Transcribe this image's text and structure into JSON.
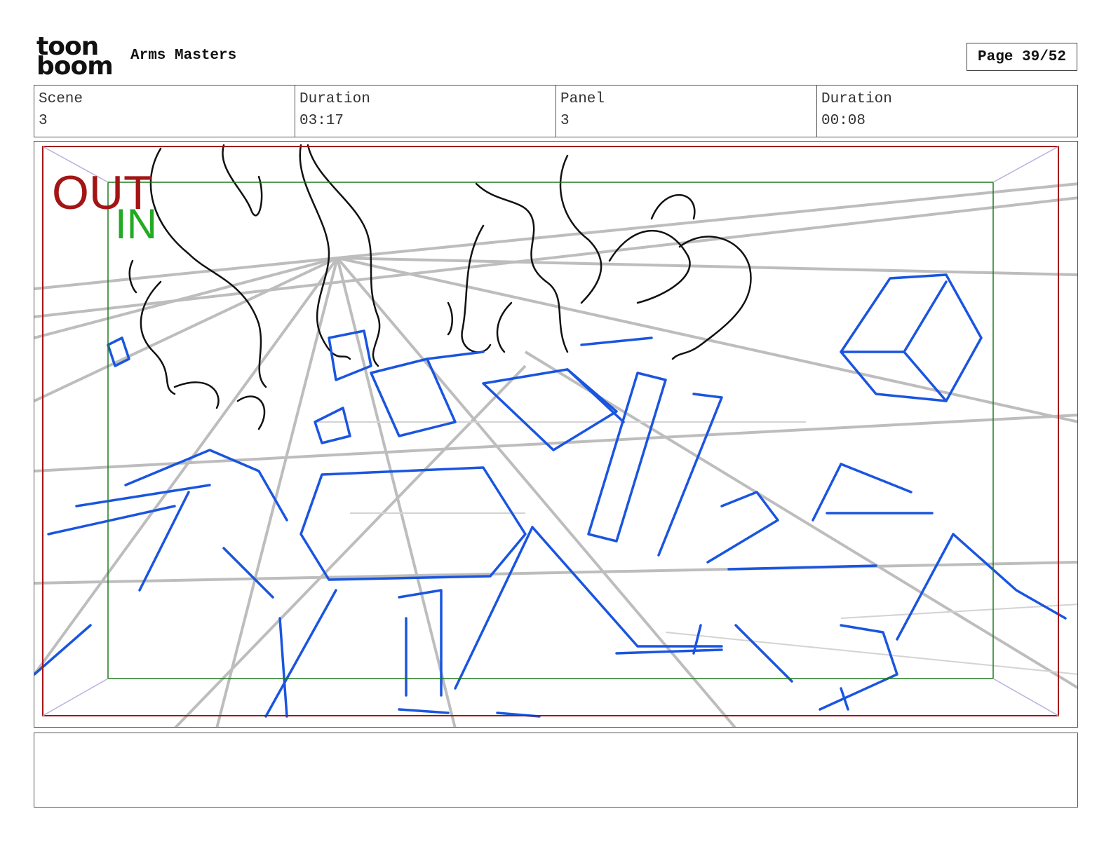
{
  "header": {
    "logo_text_line1": "toon",
    "logo_text_line2": "boom",
    "project_title": "Arms Masters",
    "page_label": "Page 39/52"
  },
  "info": {
    "scene_label": "Scene",
    "scene_value": "3",
    "scene_duration_label": "Duration",
    "scene_duration_value": "03:17",
    "panel_label": "Panel",
    "panel_value": "3",
    "panel_duration_label": "Duration",
    "panel_duration_value": "00:08"
  },
  "frame_labels": {
    "out": "OUT",
    "in": "IN"
  },
  "colors": {
    "out_frame": "#a31515",
    "in_frame": "#1f7a1f",
    "in_text": "#22aa22",
    "blue_lines": "#1a55e0",
    "gray_lines": "#b8b8b8"
  },
  "notes": {
    "text": ""
  }
}
